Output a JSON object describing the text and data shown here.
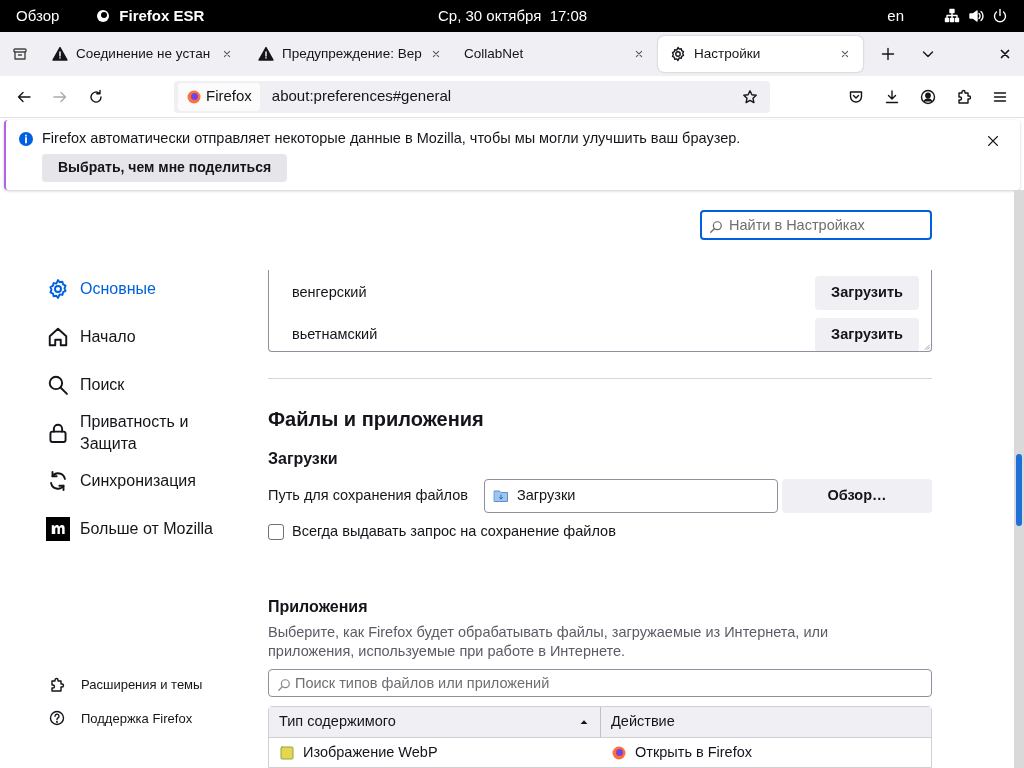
{
  "top_bar": {
    "activities": "Обзор",
    "app": "Firefox ESR",
    "clock": "Ср, 30 октября  17:08",
    "keyboard": "en"
  },
  "tabs": [
    {
      "title": "Соединение не устан",
      "kind": "warning",
      "selected": false
    },
    {
      "title": "Предупреждение: Вер",
      "kind": "warning",
      "selected": false
    },
    {
      "title": "CollabNet",
      "kind": "plain",
      "selected": false
    },
    {
      "title": "Настройки",
      "kind": "settings",
      "selected": true
    }
  ],
  "nav_bar": {
    "identity": "Firefox",
    "url": "about:preferences#general"
  },
  "notification": {
    "message": "Firefox автоматически отправляет некоторые данные в Mozilla, чтобы мы могли улучшить ваш браузер.",
    "button": "Выбрать, чем мне поделиться"
  },
  "search": {
    "placeholder": "Найти в Настройках"
  },
  "sidebar": {
    "items": [
      {
        "label": "Основные",
        "selected": true
      },
      {
        "label": "Начало",
        "selected": false
      },
      {
        "label": "Поиск",
        "selected": false
      },
      {
        "label": "Приватность и Защита",
        "selected": false
      },
      {
        "label": "Синхронизация",
        "selected": false
      },
      {
        "label": "Больше от Mozilla",
        "selected": false
      }
    ],
    "footer": [
      "Расширения и темы",
      "Поддержка Firefox"
    ]
  },
  "dictionaries": [
    {
      "name": "венгерский",
      "button": "Загрузить"
    },
    {
      "name": "вьетнамский",
      "button": "Загрузить"
    }
  ],
  "files_section": {
    "title": "Файлы и приложения",
    "downloads_title": "Загрузки",
    "path_label": "Путь для сохранения файлов",
    "path_value": "Загрузки",
    "browse": "Обзор…",
    "always_ask": {
      "label": "Всегда выдавать запрос на сохранение файлов",
      "checked": false
    }
  },
  "applications": {
    "title": "Приложения",
    "description": "Выберите, как Firefox будет обрабатывать файлы, загружаемые из Интернета, или приложения, используемые при работе в Интернете.",
    "search_placeholder": "Поиск типов файлов или приложений",
    "columns": [
      "Тип содержимого",
      "Действие"
    ],
    "rows": [
      {
        "type": "Изображение WebP",
        "action": "Открыть в Firefox"
      }
    ]
  }
}
